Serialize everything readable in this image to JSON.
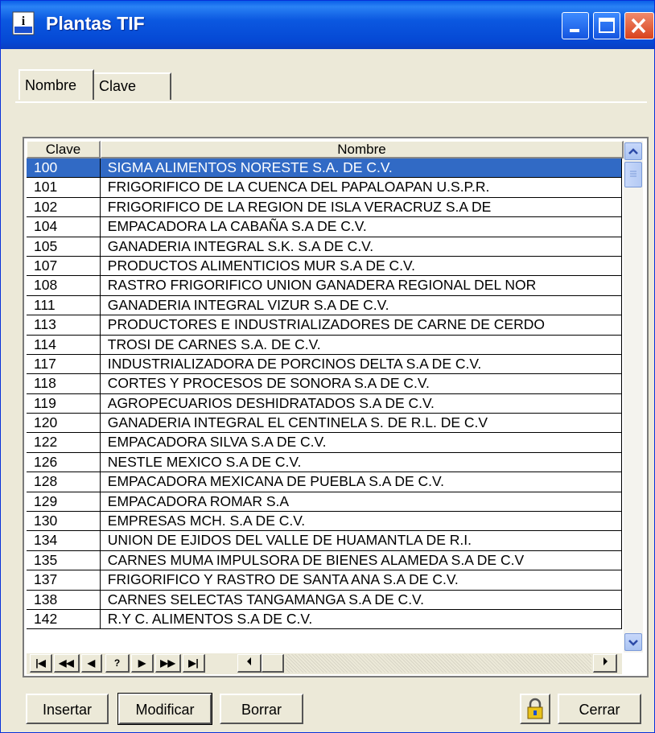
{
  "window": {
    "title": "Plantas TIF"
  },
  "tabs": [
    {
      "label": "Nombre"
    },
    {
      "label": "Clave"
    }
  ],
  "table": {
    "headers": {
      "clave": "Clave",
      "nombre": "Nombre"
    },
    "rows": [
      {
        "clave": "100",
        "nombre": "SIGMA ALIMENTOS NORESTE S.A. DE C.V."
      },
      {
        "clave": "101",
        "nombre": "FRIGORIFICO DE LA CUENCA DEL PAPALOAPAN U.S.P.R."
      },
      {
        "clave": "102",
        "nombre": "FRIGORIFICO DE LA REGION DE ISLA  VERACRUZ S.A DE"
      },
      {
        "clave": "104",
        "nombre": "EMPACADORA LA CABAÑA S.A DE C.V."
      },
      {
        "clave": "105",
        "nombre": "GANADERIA INTEGRAL S.K. S.A DE C.V."
      },
      {
        "clave": "107",
        "nombre": "PRODUCTOS ALIMENTICIOS MUR  S.A DE C.V."
      },
      {
        "clave": "108",
        "nombre": "RASTRO FRIGORIFICO UNION GANADERA REGIONAL DEL NOR"
      },
      {
        "clave": "111",
        "nombre": "GANADERIA INTEGRAL VIZUR  S.A DE C.V."
      },
      {
        "clave": "113",
        "nombre": "PRODUCTORES E INDUSTRIALIZADORES DE CARNE DE CERDO"
      },
      {
        "clave": "114",
        "nombre": "TROSI DE CARNES S.A. DE C.V."
      },
      {
        "clave": "117",
        "nombre": "INDUSTRIALIZADORA DE PORCINOS DELTA  S.A DE C.V."
      },
      {
        "clave": "118",
        "nombre": "CORTES Y PROCESOS DE SONORA  S.A DE C.V."
      },
      {
        "clave": "119",
        "nombre": "AGROPECUARIOS DESHIDRATADOS  S.A DE C.V."
      },
      {
        "clave": "120",
        "nombre": "GANADERIA INTEGRAL EL CENTINELA  S. DE R.L. DE C.V"
      },
      {
        "clave": "122",
        "nombre": "EMPACADORA SILVA S.A DE C.V."
      },
      {
        "clave": "126",
        "nombre": "NESTLE MEXICO  S.A DE C.V."
      },
      {
        "clave": "128",
        "nombre": "EMPACADORA MEXICANA DE PUEBLA S.A DE C.V."
      },
      {
        "clave": "129",
        "nombre": "EMPACADORA ROMAR  S.A"
      },
      {
        "clave": "130",
        "nombre": "EMPRESAS MCH.  S.A DE C.V."
      },
      {
        "clave": "134",
        "nombre": "UNION DE EJIDOS DEL VALLE DE HUAMANTLA  DE R.I."
      },
      {
        "clave": "135",
        "nombre": "CARNES MUMA IMPULSORA DE BIENES ALAMEDA S.A DE C.V"
      },
      {
        "clave": "137",
        "nombre": "FRIGORIFICO Y RASTRO DE SANTA ANA  S.A DE C.V."
      },
      {
        "clave": "138",
        "nombre": "CARNES SELECTAS TANGAMANGA  S.A DE C.V."
      },
      {
        "clave": "142",
        "nombre": "R.Y C. ALIMENTOS  S.A DE C.V."
      }
    ]
  },
  "navigator": {
    "first": "|◀",
    "prior_page": "◀◀",
    "prior": "◀",
    "search": "?",
    "next": "▶",
    "next_page": "▶▶",
    "last": "▶|"
  },
  "buttons": {
    "insert": "Insertar",
    "modify": "Modificar",
    "delete": "Borrar",
    "close": "Cerrar"
  },
  "colors": {
    "title_bar": "#0548d4",
    "selection": "#316ac5",
    "window_bg": "#ece9d8"
  }
}
